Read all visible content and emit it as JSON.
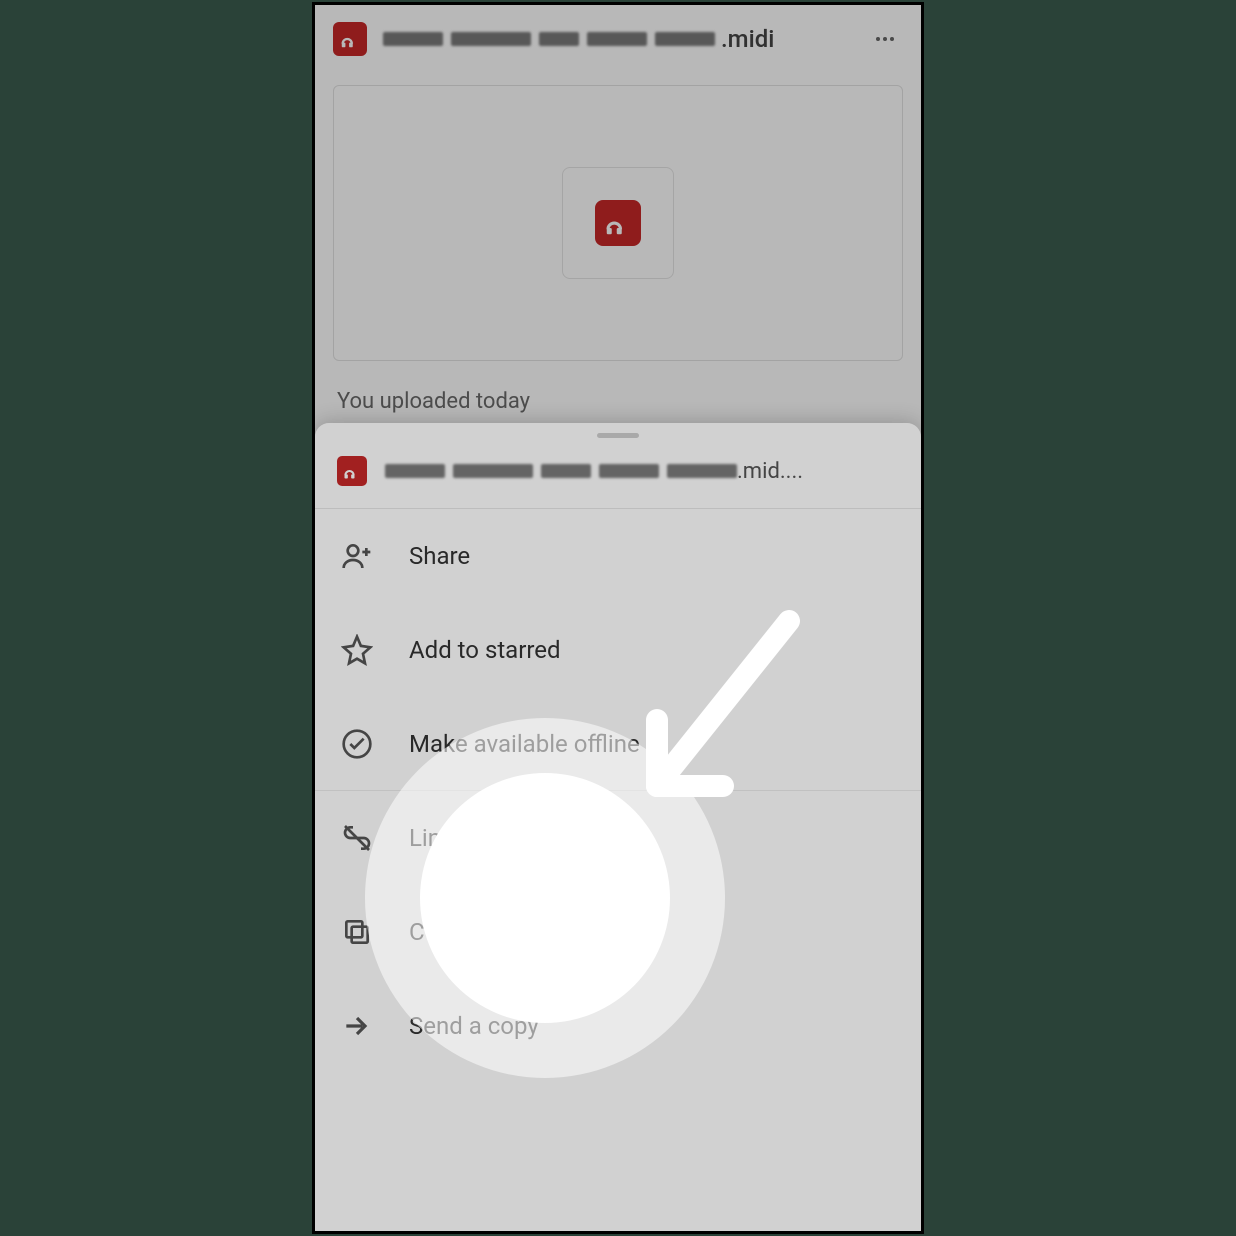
{
  "header": {
    "filename_extension": ".midi",
    "more_label": "More"
  },
  "upload_info": "You uploaded today",
  "sheet": {
    "filename_extension": ".mid....",
    "menu": {
      "share": "Share",
      "add_to_starred": "Add to starred",
      "make_available_offline": "Make available offline",
      "link_sharing_off": "Link sharing off",
      "copy_link": "Copy link",
      "send_a_copy": "Send a copy"
    }
  },
  "colors": {
    "accent": "#c62828",
    "background_dim": "rgba(0,0,0,0.28)"
  }
}
